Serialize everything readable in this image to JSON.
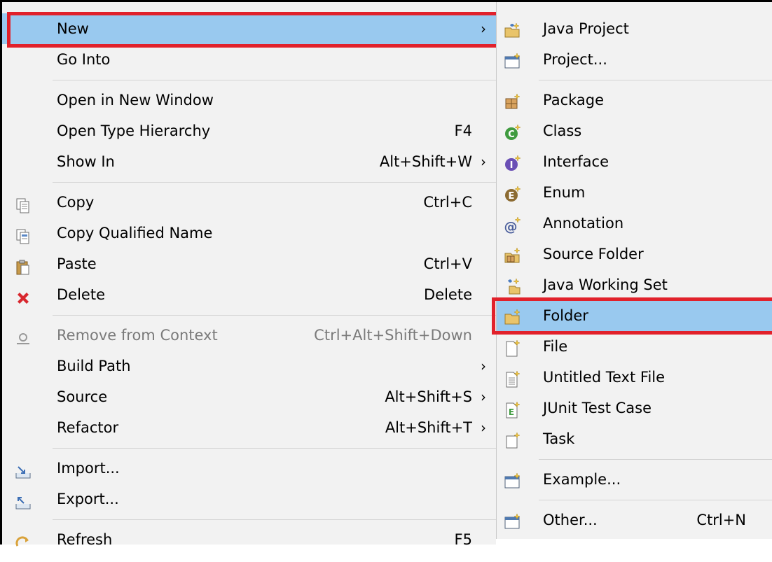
{
  "main_menu": {
    "items": [
      {
        "label": "New",
        "shortcut": "",
        "arrow": "›",
        "icon": "none"
      },
      {
        "label": "Go Into",
        "shortcut": "",
        "arrow": "",
        "icon": "none"
      },
      {
        "label": "Open in New Window",
        "shortcut": "",
        "arrow": "",
        "icon": "none"
      },
      {
        "label": "Open Type Hierarchy",
        "shortcut": "F4",
        "arrow": "",
        "icon": "none"
      },
      {
        "label": "Show In",
        "shortcut": "Alt+Shift+W",
        "arrow": "›",
        "icon": "none"
      },
      {
        "label": "Copy",
        "shortcut": "Ctrl+C",
        "arrow": "",
        "icon": "copy-icon"
      },
      {
        "label": "Copy Qualified Name",
        "shortcut": "",
        "arrow": "",
        "icon": "copy-qualified-name-icon"
      },
      {
        "label": "Paste",
        "shortcut": "Ctrl+V",
        "arrow": "",
        "icon": "paste-icon"
      },
      {
        "label": "Delete",
        "shortcut": "Delete",
        "arrow": "",
        "icon": "delete-icon"
      },
      {
        "label": "Remove from Context",
        "shortcut": "Ctrl+Alt+Shift+Down",
        "arrow": "",
        "icon": "remove-context-icon"
      },
      {
        "label": "Build Path",
        "shortcut": "",
        "arrow": "›",
        "icon": "none"
      },
      {
        "label": "Source",
        "shortcut": "Alt+Shift+S",
        "arrow": "›",
        "icon": "none"
      },
      {
        "label": "Refactor",
        "shortcut": "Alt+Shift+T",
        "arrow": "›",
        "icon": "none"
      },
      {
        "label": "Import...",
        "shortcut": "",
        "arrow": "",
        "icon": "import-icon"
      },
      {
        "label": "Export...",
        "shortcut": "",
        "arrow": "",
        "icon": "export-icon"
      },
      {
        "label": "Refresh",
        "shortcut": "F5",
        "arrow": "",
        "icon": "refresh-icon"
      }
    ]
  },
  "new_submenu": {
    "items": [
      {
        "label": "Java Project",
        "shortcut": "",
        "icon": "java-project-icon"
      },
      {
        "label": "Project...",
        "shortcut": "",
        "icon": "project-icon"
      },
      {
        "label": "Package",
        "shortcut": "",
        "icon": "package-icon"
      },
      {
        "label": "Class",
        "shortcut": "",
        "icon": "class-icon"
      },
      {
        "label": "Interface",
        "shortcut": "",
        "icon": "interface-icon"
      },
      {
        "label": "Enum",
        "shortcut": "",
        "icon": "enum-icon"
      },
      {
        "label": "Annotation",
        "shortcut": "",
        "icon": "annotation-icon"
      },
      {
        "label": "Source Folder",
        "shortcut": "",
        "icon": "source-folder-icon"
      },
      {
        "label": "Java Working Set",
        "shortcut": "",
        "icon": "java-working-set-icon"
      },
      {
        "label": "Folder",
        "shortcut": "",
        "icon": "folder-icon"
      },
      {
        "label": "File",
        "shortcut": "",
        "icon": "file-icon"
      },
      {
        "label": "Untitled Text File",
        "shortcut": "",
        "icon": "untitled-text-file-icon"
      },
      {
        "label": "JUnit Test Case",
        "shortcut": "",
        "icon": "junit-test-case-icon"
      },
      {
        "label": "Task",
        "shortcut": "",
        "icon": "task-icon"
      },
      {
        "label": "Example...",
        "shortcut": "",
        "icon": "example-icon"
      },
      {
        "label": "Other...",
        "shortcut": "Ctrl+N",
        "icon": "other-icon"
      }
    ]
  },
  "colors": {
    "highlight": "#99c9ef",
    "annotation_box": "#e1212b",
    "menu_bg": "#f2f2f2",
    "disabled_text": "#7a7a7a",
    "class_green": "#3f9b3f",
    "interface_purple": "#6a4fb5",
    "enum_brown": "#8c6b32",
    "delete_red": "#d8272e"
  }
}
